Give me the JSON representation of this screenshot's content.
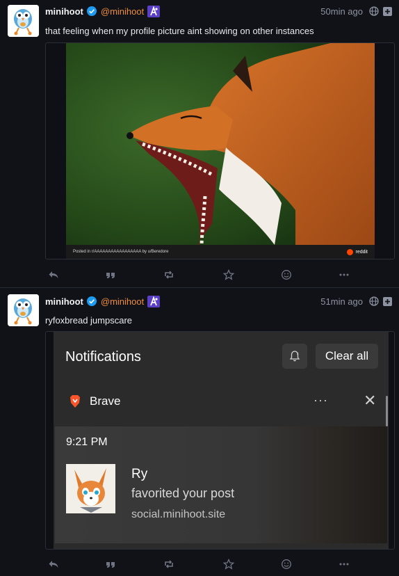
{
  "posts": [
    {
      "author": "minihoot",
      "handle": "@minihoot",
      "time": "50min ago",
      "text": "that feeling when my profile picture aint showing on other instances",
      "media": {
        "type": "reddit-screenshot",
        "caption": "Posted in r/AAAAAAAAAAAAAAAAA by u/Beredore",
        "brand": "reddit"
      }
    },
    {
      "author": "minihoot",
      "handle": "@minihoot",
      "time": "51min ago",
      "text": "ryfoxbread jumpscare",
      "media": {
        "type": "windows-notification",
        "title": "Notifications",
        "clear_label": "Clear all",
        "app_name": "Brave",
        "more": "···",
        "close": "✕",
        "card_time": "9:21 PM",
        "card_name": "Ry",
        "card_action": "favorited your post",
        "card_site": "social.minihoot.site"
      }
    }
  ],
  "actions": [
    "reply-icon",
    "quote-icon",
    "boost-icon",
    "favourite-icon",
    "react-icon",
    "more-icon"
  ],
  "colors": {
    "background": "#101217",
    "handle": "#f08d3b",
    "verified": "#1d9bf0",
    "muted": "#8d93a1"
  }
}
